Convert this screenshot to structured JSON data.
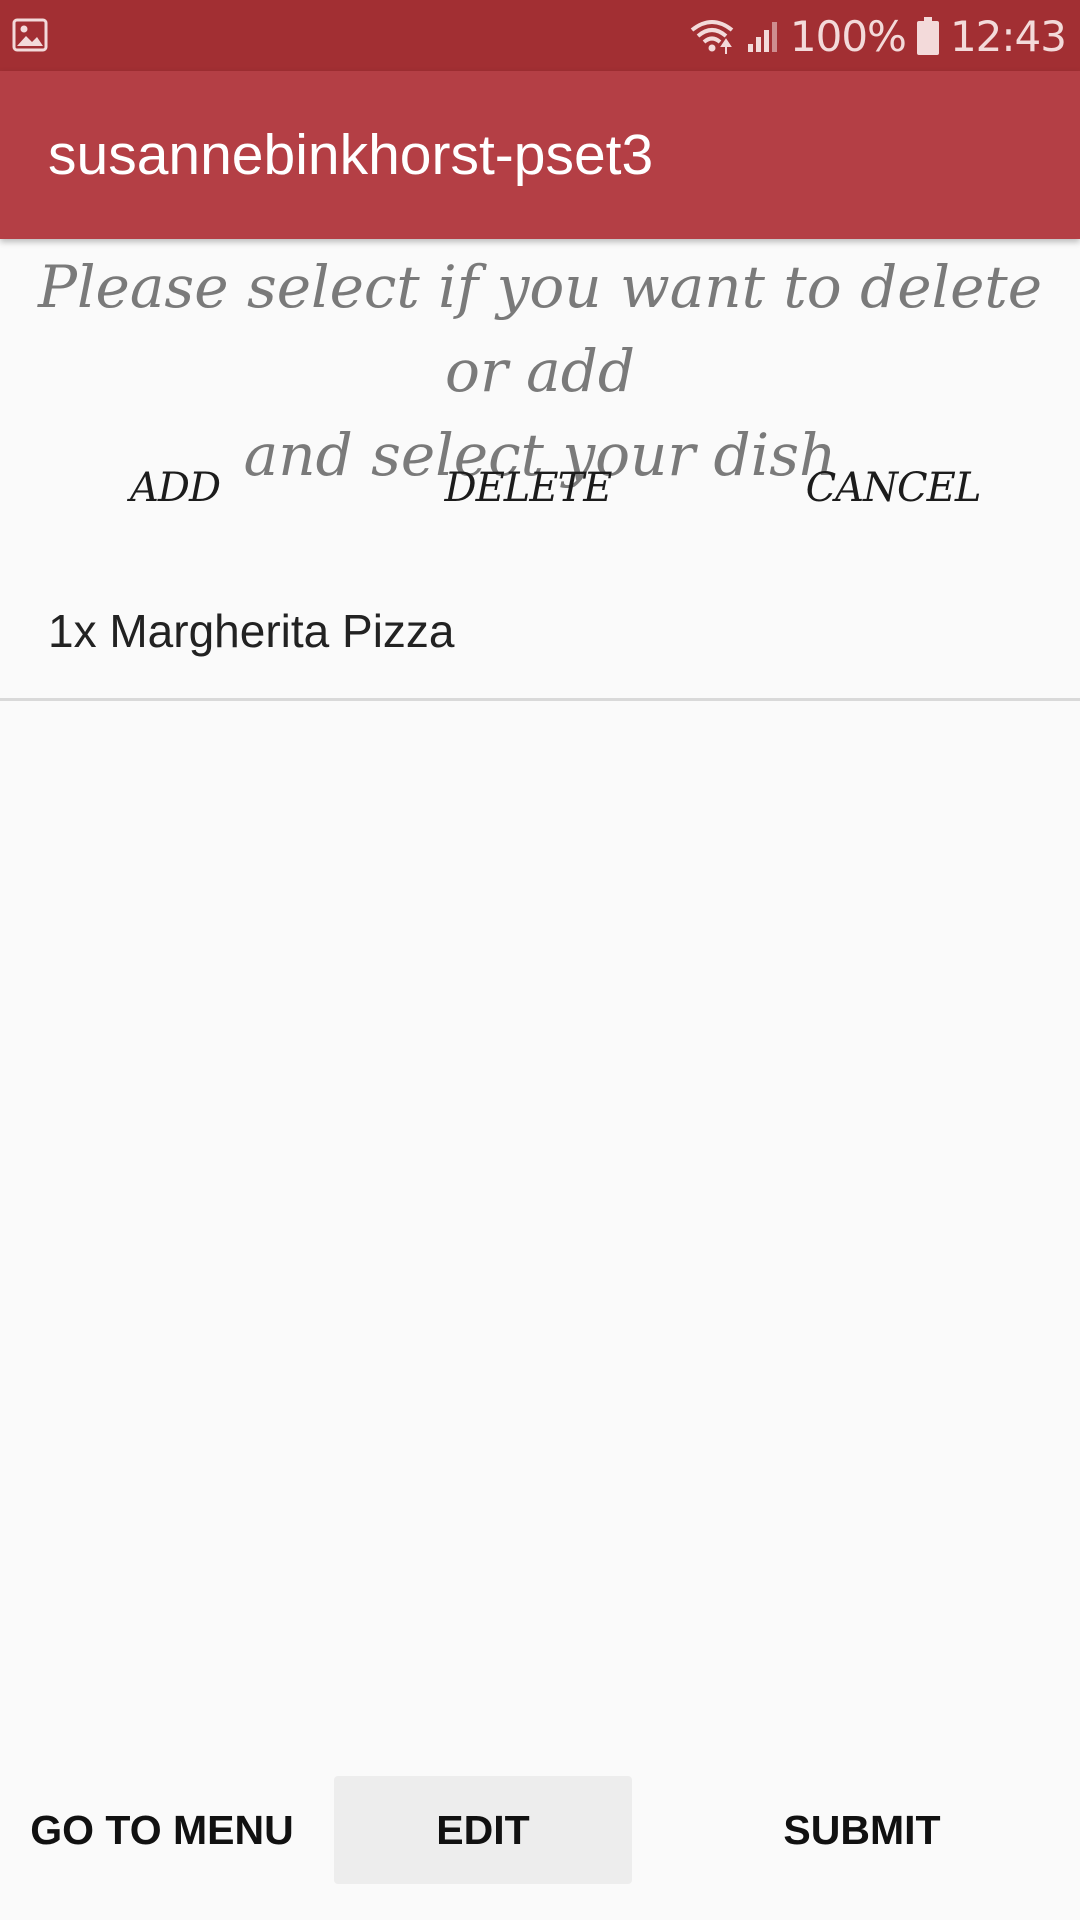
{
  "status_bar": {
    "left_icon": "gallery-notification-icon",
    "wifi_icon": "wifi-icon",
    "signal_icon": "signal-icon",
    "battery_percent": "100%",
    "battery_icon": "battery-icon",
    "time": "12:43",
    "background_color": "#a22f33"
  },
  "app_bar": {
    "title": "susannebinkhorst-pset3",
    "background_color": "#b43f45"
  },
  "instruction": {
    "line1": "Please select if you want to delete or add",
    "line2": "and select your dish"
  },
  "actions": {
    "add_label": "ADD",
    "delete_label": "DELETE",
    "cancel_label": "CANCEL"
  },
  "order_list": {
    "items": [
      {
        "label": "1x Margherita Pizza"
      }
    ]
  },
  "bottom_bar": {
    "go_to_menu_label": "GO TO MENU",
    "edit_label": "EDIT",
    "submit_label": "SUBMIT"
  }
}
